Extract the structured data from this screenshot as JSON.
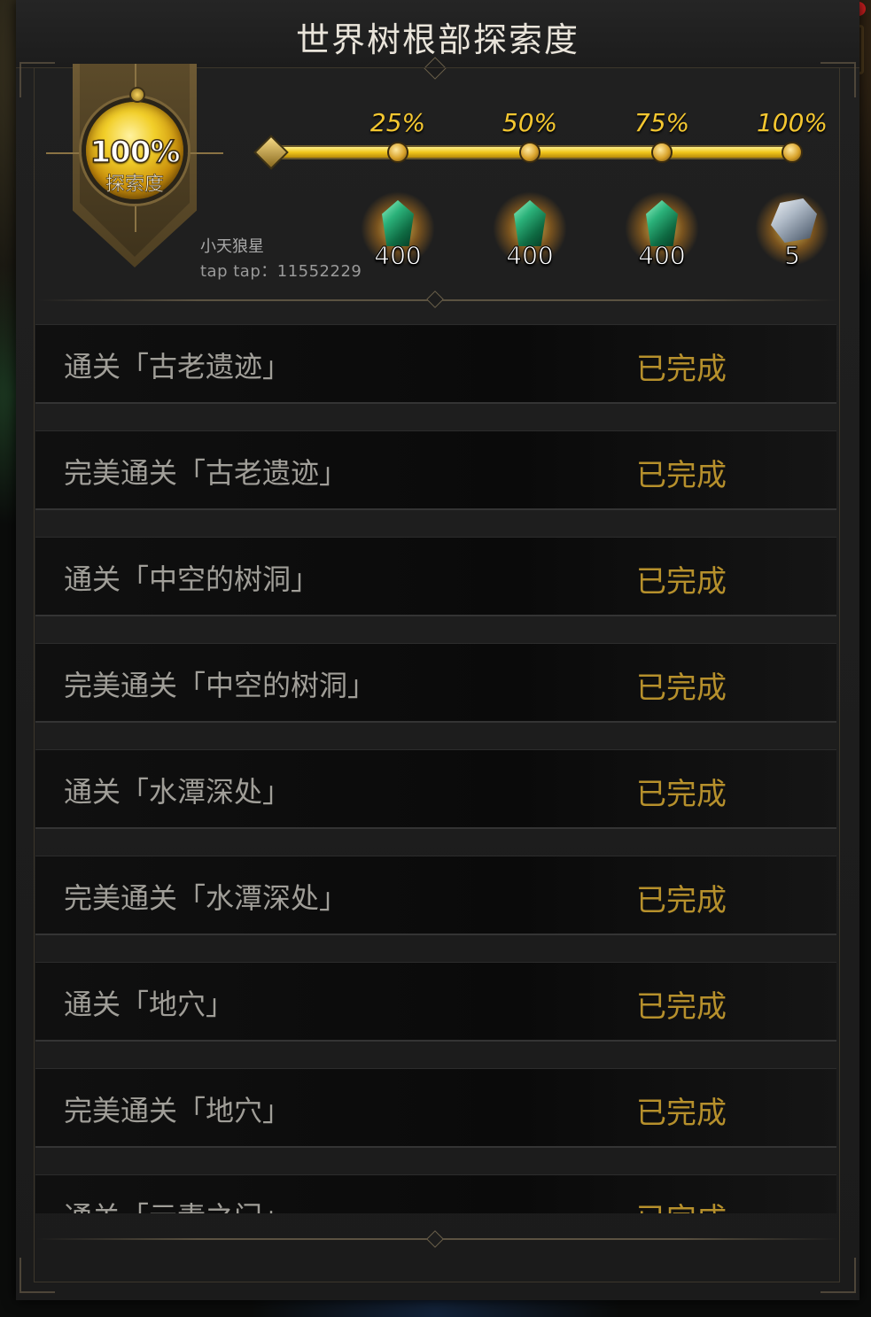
{
  "title": "世界树根部探索度",
  "badge": {
    "percent": "100%",
    "label": "探索度"
  },
  "player": {
    "name": "小天狼星",
    "tap_id": "tap tap：11552229"
  },
  "progress": {
    "value": 1.0,
    "milestones": [
      {
        "label": "25%",
        "reward_icon": "green-gem-icon",
        "reward_count": "400"
      },
      {
        "label": "50%",
        "reward_icon": "green-gem-icon",
        "reward_count": "400"
      },
      {
        "label": "75%",
        "reward_icon": "green-gem-icon",
        "reward_count": "400"
      },
      {
        "label": "100%",
        "reward_icon": "silver-ore-icon",
        "reward_count": "5"
      }
    ]
  },
  "tasks": [
    {
      "name": "通关「古老遗迹」",
      "status": "已完成"
    },
    {
      "name": "完美通关「古老遗迹」",
      "status": "已完成"
    },
    {
      "name": "通关「中空的树洞」",
      "status": "已完成"
    },
    {
      "name": "完美通关「中空的树洞」",
      "status": "已完成"
    },
    {
      "name": "通关「水潭深处」",
      "status": "已完成"
    },
    {
      "name": "完美通关「水潭深处」",
      "status": "已完成"
    },
    {
      "name": "通关「地穴」",
      "status": "已完成"
    },
    {
      "name": "完美通关「地穴」",
      "status": "已完成"
    },
    {
      "name": "通关「元素之门」",
      "status": "已完成"
    }
  ],
  "colors": {
    "gold": "#f4c730",
    "status": "#b6902c",
    "task_text": "#a09e98"
  }
}
